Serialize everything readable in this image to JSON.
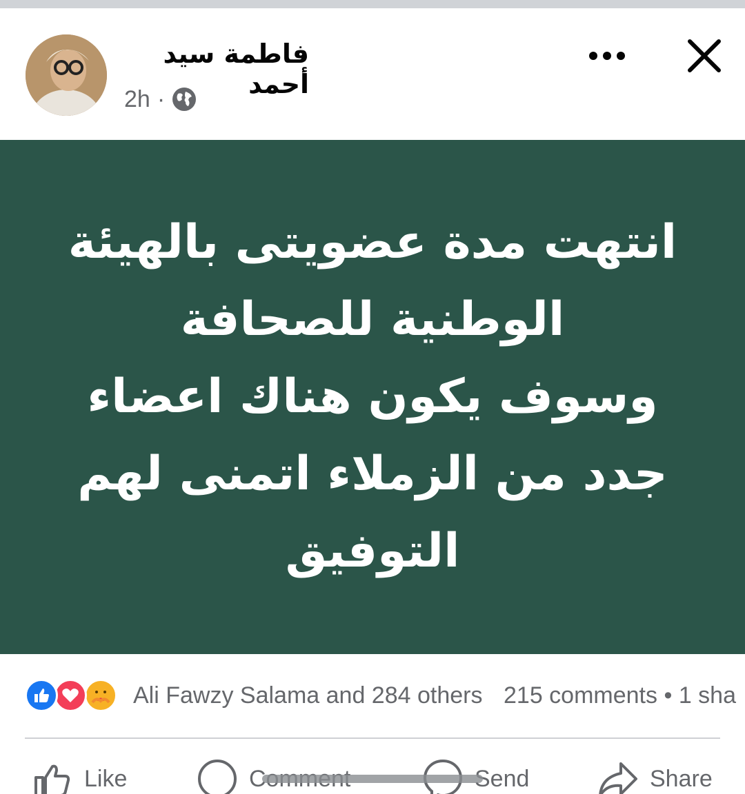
{
  "post": {
    "author": "فاطمة سيد أحمد",
    "time": "2h",
    "separator": "·",
    "audience_icon": "globe-icon",
    "more_icon": "more-dots-icon",
    "close_icon": "close-icon",
    "image_background": "#2b5549",
    "image_text": "انتهت مدة عضويتى بالهيئة\nالوطنية للصحافة\nوسوف يكون هناك اعضاء\nجدد من الزملاء اتمنى لهم\nالتوفيق"
  },
  "reactions": {
    "icons": [
      "like-reaction-icon",
      "love-reaction-icon",
      "care-reaction-icon"
    ],
    "summary": "Ali Fawzy Salama and 284 others",
    "comments": "215 comments",
    "bullet": "•",
    "shares": "1 sha"
  },
  "actions": {
    "like": "Like",
    "comment": "Comment",
    "send": "Send",
    "share": "Share"
  },
  "colors": {
    "accent": "#1877f2",
    "love": "#f33e58",
    "care": "#f7b125",
    "secondary_text": "#65676b"
  }
}
